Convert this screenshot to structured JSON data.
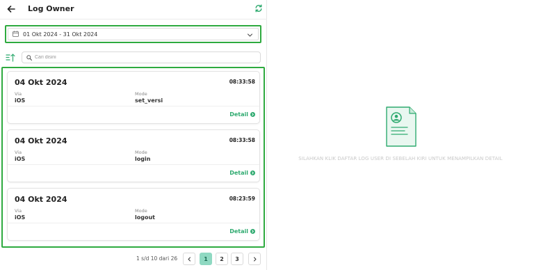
{
  "header": {
    "title": "Log Owner"
  },
  "filter": {
    "date_range": "01 Okt 2024 - 31 Okt 2024"
  },
  "search": {
    "placeholder": "Cari disini"
  },
  "labels": {
    "via": "Via",
    "mode": "Mode",
    "detail": "Detail"
  },
  "logs": [
    {
      "date": "04 Okt 2024",
      "time": "08:33:58",
      "via": "iOS",
      "mode": "set_versi"
    },
    {
      "date": "04 Okt 2024",
      "time": "08:33:58",
      "via": "iOS",
      "mode": "login"
    },
    {
      "date": "04 Okt 2024",
      "time": "08:23:59",
      "via": "iOS",
      "mode": "logout"
    }
  ],
  "pagination": {
    "info": "1 s/d 10 dari 26",
    "pages": [
      "1",
      "2",
      "3"
    ],
    "active": "1"
  },
  "empty_state": {
    "message": "SILAHKAN KLIK DAFTAR LOG USER DI SEBELAH KIRI UNTUK MENAMPILKAN DETAIL"
  },
  "colors": {
    "accent": "#2eaa6f",
    "highlight_border": "#2eaa3f",
    "active_page": "#8fd9c2"
  }
}
